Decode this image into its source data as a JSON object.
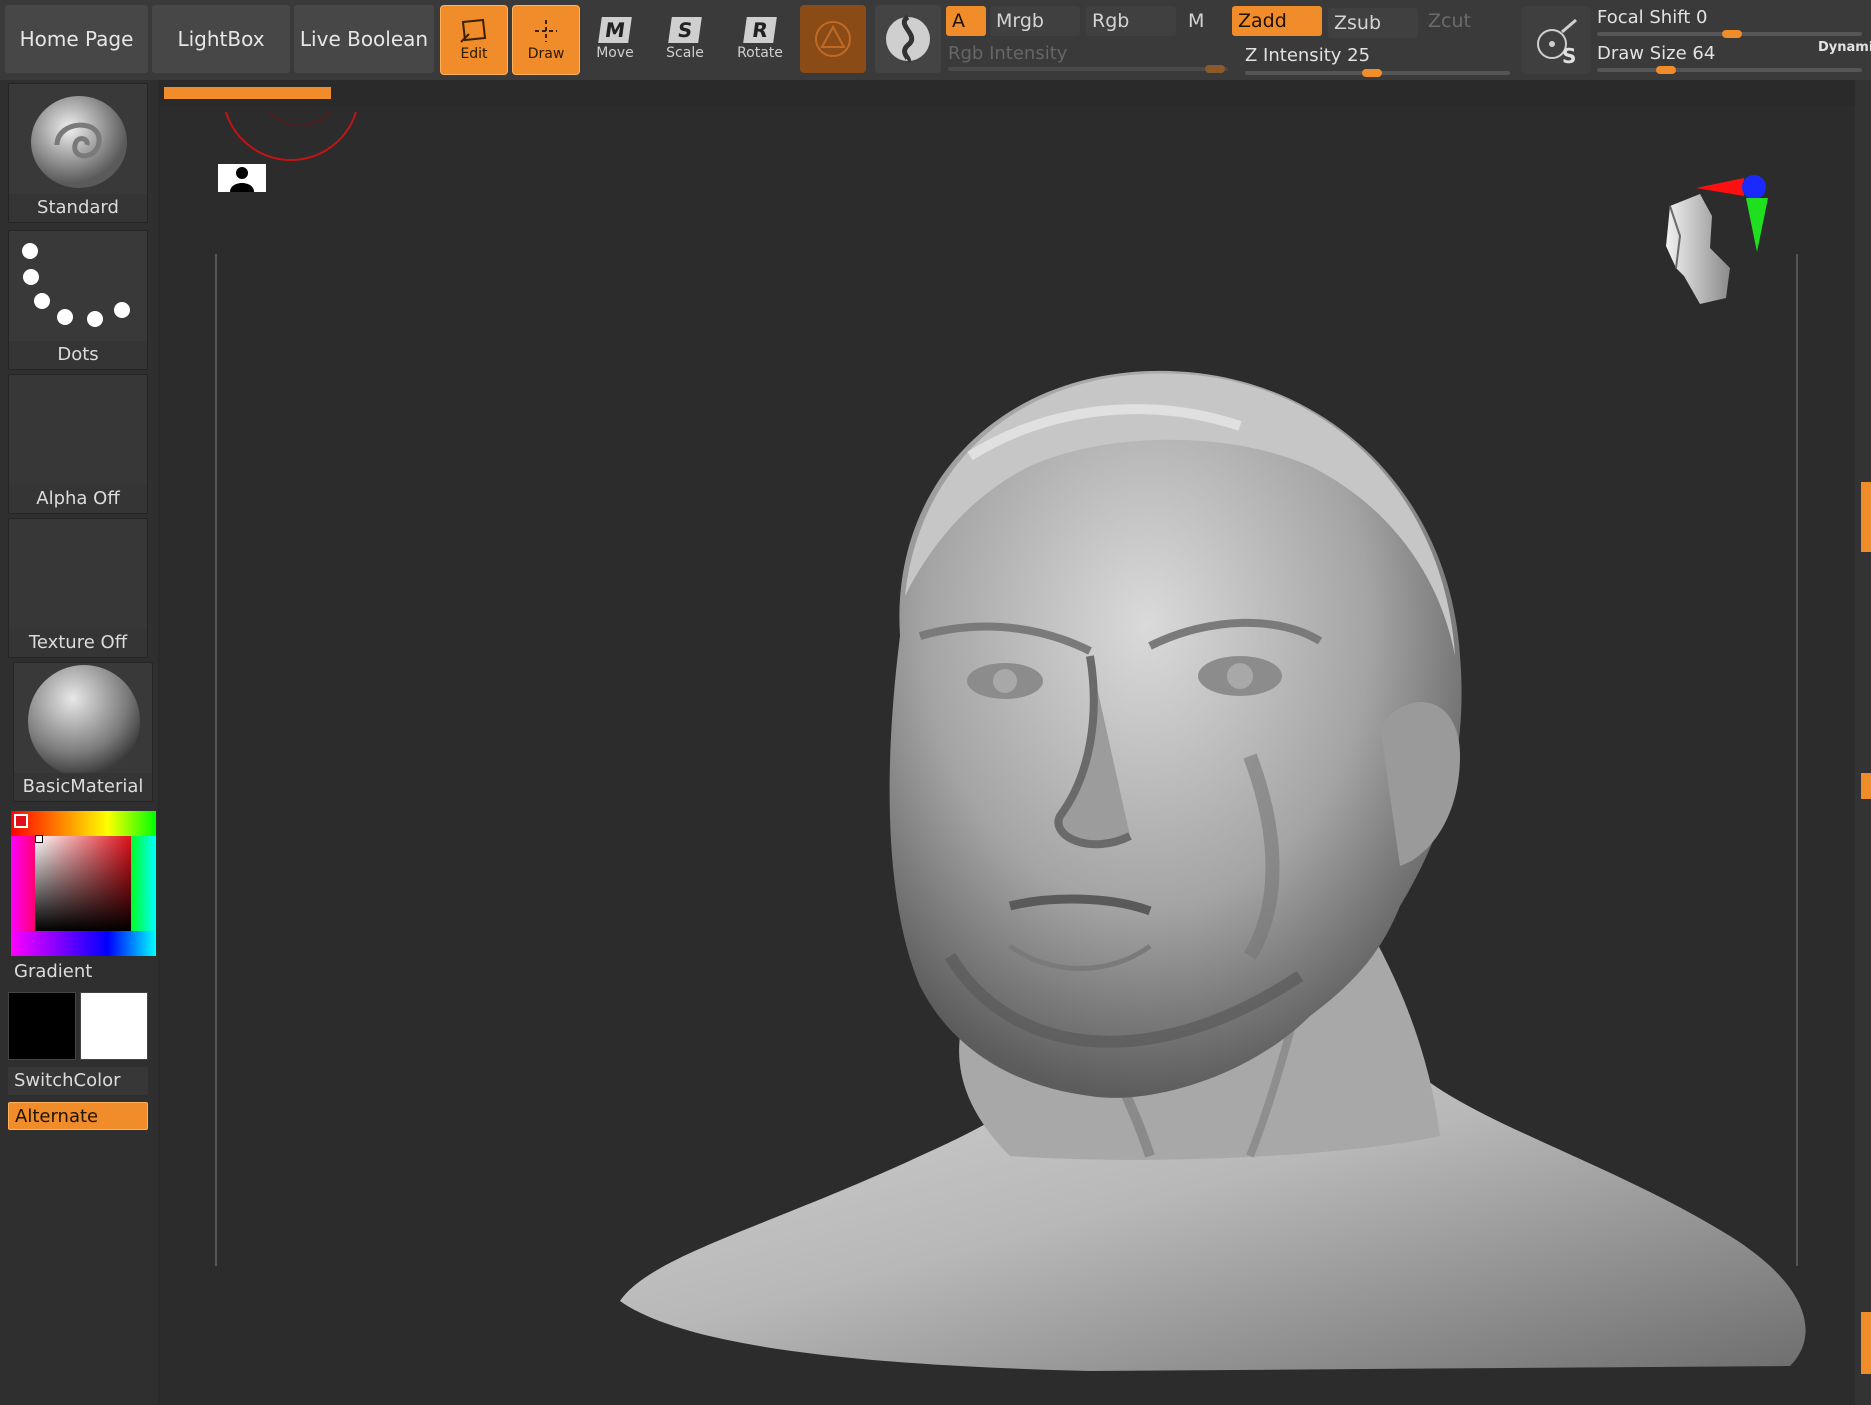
{
  "nav": {
    "home_page": "Home Page",
    "lightbox": "LightBox",
    "live_boolean": "Live Boolean"
  },
  "tools": {
    "edit": "Edit",
    "draw": "Draw",
    "move": "Move",
    "scale": "Scale",
    "rotate": "Rotate",
    "move_icon_letter": "M",
    "scale_icon_letter": "S",
    "rotate_icon_letter": "R"
  },
  "modes": {
    "a": "A",
    "mrgb": "Mrgb",
    "rgb": "Rgb",
    "m": "M",
    "zadd": "Zadd",
    "zsub": "Zsub",
    "zcut": "Zcut"
  },
  "sliders": {
    "rgb_intensity_label": "Rgb Intensity",
    "z_intensity_label": "Z Intensity",
    "z_intensity_value": "25",
    "focal_shift_label": "Focal Shift",
    "focal_shift_value": "0",
    "draw_size_label": "Draw Size",
    "draw_size_value": "64",
    "dynamic_label": "Dynamic"
  },
  "lightbox_icon_letter": "S",
  "left_panel": {
    "brush": "Standard",
    "stroke": "Dots",
    "alpha": "Alpha Off",
    "texture": "Texture Off",
    "material": "BasicMaterial",
    "gradient": "Gradient",
    "switch_color": "SwitchColor",
    "alternate": "Alternate"
  },
  "colors": {
    "accent": "#f08c2a",
    "main_color": "#000000",
    "secondary_color": "#ffffff"
  }
}
